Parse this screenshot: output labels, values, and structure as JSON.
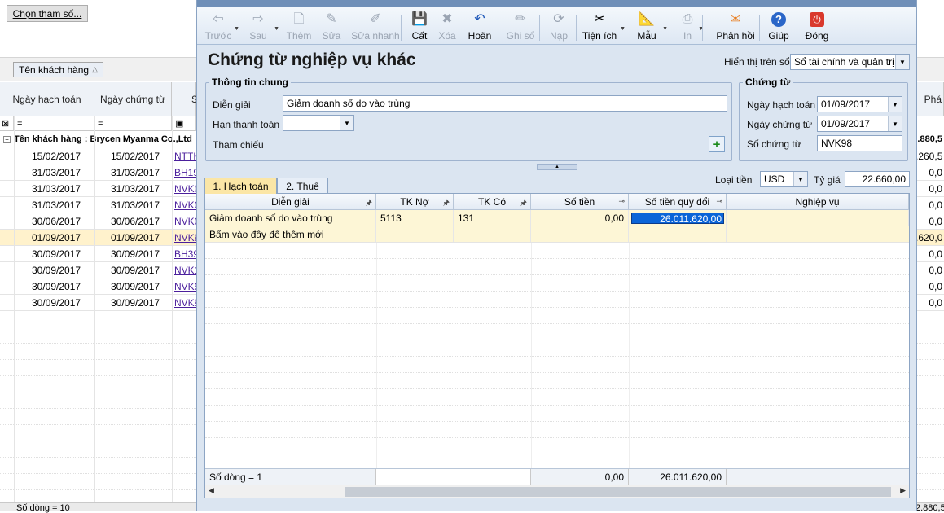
{
  "background": {
    "param_button": "Chọn tham số...",
    "group_chip": "Tên khách hàng",
    "columns": [
      "Ngày hạch toán",
      "Ngày chứng từ",
      "S"
    ],
    "right_header": "Phá",
    "group_row": "Tên khách hàng : Brycen Myanma Co.,Ltd",
    "group_total": ".880,5",
    "rows": [
      {
        "d1": "15/02/2017",
        "d2": "15/02/2017",
        "doc": "NTTK",
        "amt": ".260,5"
      },
      {
        "d1": "31/03/2017",
        "d2": "31/03/2017",
        "doc": "BH19",
        "amt": "0,0"
      },
      {
        "d1": "31/03/2017",
        "d2": "31/03/2017",
        "doc": "NVK0",
        "amt": "0,0"
      },
      {
        "d1": "31/03/2017",
        "d2": "31/03/2017",
        "doc": "NVK0",
        "amt": "0,0"
      },
      {
        "d1": "30/06/2017",
        "d2": "30/06/2017",
        "doc": "NVK0",
        "amt": "0,0"
      },
      {
        "d1": "01/09/2017",
        "d2": "01/09/2017",
        "doc": "NVK9",
        "amt": ".620,0"
      },
      {
        "d1": "30/09/2017",
        "d2": "30/09/2017",
        "doc": "BH39",
        "amt": "0,0"
      },
      {
        "d1": "30/09/2017",
        "d2": "30/09/2017",
        "doc": "NVK1",
        "amt": "0,0"
      },
      {
        "d1": "30/09/2017",
        "d2": "30/09/2017",
        "doc": "NVK9",
        "amt": "0,0"
      },
      {
        "d1": "30/09/2017",
        "d2": "30/09/2017",
        "doc": "NVK9",
        "amt": "0,0"
      }
    ],
    "status": "Số dòng = 10",
    "status_right": "2.880,5"
  },
  "toolbar": {
    "items": [
      {
        "label": "Trước",
        "icon": "arrow-left-icon",
        "glyph": "⇦",
        "disabled": true
      },
      {
        "label": "Sau",
        "icon": "arrow-right-icon",
        "glyph": "⇨",
        "disabled": true
      },
      {
        "label": "Thêm",
        "icon": "add-doc-icon",
        "glyph": "🗋",
        "disabled": true
      },
      {
        "label": "Sửa",
        "icon": "edit-doc-icon",
        "glyph": "✎",
        "disabled": true
      },
      {
        "label": "Sửa nhanh",
        "icon": "quick-edit-icon",
        "glyph": "✐",
        "disabled": true
      },
      {
        "label": "Cất",
        "icon": "save-icon",
        "glyph": "💾",
        "disabled": false
      },
      {
        "label": "Xóa",
        "icon": "delete-icon",
        "glyph": "✖",
        "disabled": true
      },
      {
        "label": "Hoãn",
        "icon": "undo-icon",
        "glyph": "↶",
        "disabled": false
      },
      {
        "label": "Ghi sổ",
        "icon": "post-icon",
        "glyph": "✏",
        "disabled": true
      },
      {
        "label": "Nạp",
        "icon": "reload-icon",
        "glyph": "⟳",
        "disabled": true
      },
      {
        "label": "Tiện ích",
        "icon": "tools-icon",
        "glyph": "✂",
        "disabled": false
      },
      {
        "label": "Mẫu",
        "icon": "template-icon",
        "glyph": "📐",
        "disabled": false
      },
      {
        "label": "In",
        "icon": "print-icon",
        "glyph": "⎙",
        "disabled": true
      },
      {
        "label": "Phản hồi",
        "icon": "feedback-icon",
        "glyph": "✉",
        "disabled": false
      },
      {
        "label": "Giúp",
        "icon": "help-icon",
        "glyph": "?",
        "disabled": false
      },
      {
        "label": "Đóng",
        "icon": "close-icon",
        "glyph": "⏻",
        "disabled": false
      }
    ]
  },
  "form": {
    "title": "Chứng từ nghiệp vụ khác",
    "display_label": "Hiển thị trên sổ",
    "display_value": "Sổ tài chính và quản trị",
    "general_legend": "Thông tin chung",
    "desc_label": "Diễn giải",
    "desc_value": "Giảm doanh số do vào trùng",
    "due_label": "Hạn thanh toán",
    "due_value": "",
    "ref_label": "Tham chiếu",
    "voucher_legend": "Chứng từ",
    "post_date_label": "Ngày hạch toán",
    "post_date": "01/09/2017",
    "voucher_date_label": "Ngày chứng từ",
    "voucher_date": "01/09/2017",
    "voucher_no_label": "Số chứng từ",
    "voucher_no": "NVK98",
    "currency_label": "Loại tiền",
    "currency": "USD",
    "rate_label": "Tỷ giá",
    "rate": "22.660,00"
  },
  "tabs": [
    {
      "label": "1. Hạch toán",
      "hotkey": "1"
    },
    {
      "label": "2. Thuế",
      "hotkey": "2"
    }
  ],
  "detail": {
    "headers": [
      "Diễn giải",
      "TK Nợ",
      "TK Có",
      "Số tiền",
      "Số tiền quy đổi",
      "Nghiệp vụ"
    ],
    "row": {
      "desc": "Giảm doanh số do vào trùng",
      "debit": "5113",
      "credit": "131",
      "amount": "0,00",
      "converted": "26.011.620,00",
      "op": ""
    },
    "new_row_hint": "Bấm vào đây để thêm mới",
    "footer_count": "Số dòng = 1",
    "footer_amount": "0,00",
    "footer_converted": "26.011.620,00"
  }
}
